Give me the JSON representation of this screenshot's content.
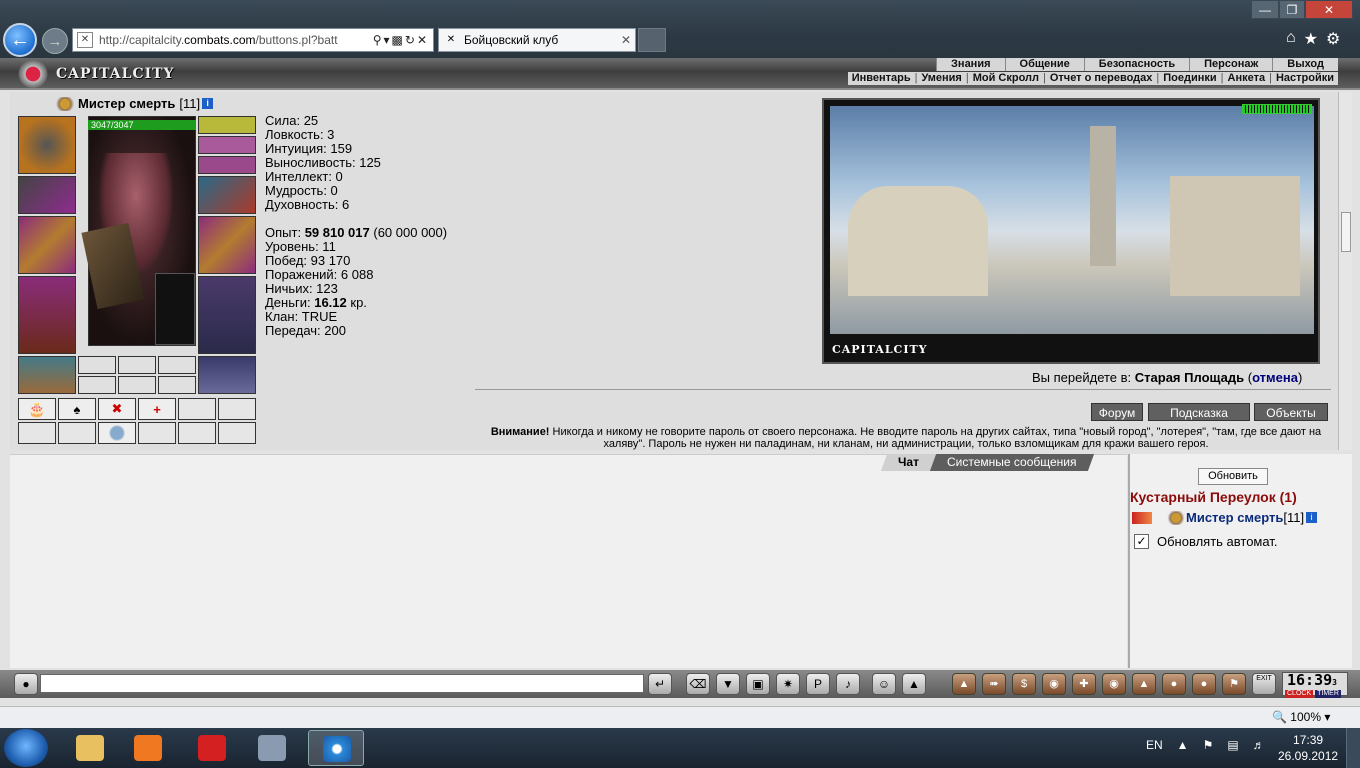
{
  "browser": {
    "url_prefix": "http://capitalcity.",
    "url_domain": "combats.com",
    "url_rest": "/buttons.pl?batt",
    "tab_title": "Бойцовский клуб",
    "zoom": "100%"
  },
  "site": {
    "logo_text": "CAPITALCITY",
    "top_menu": [
      "Знания",
      "Общение",
      "Безопасность",
      "Персонаж",
      "Выход"
    ],
    "sub_menu": [
      "Инвентарь",
      "Умения",
      "Мой Скролл",
      "Отчет о переводах",
      "Поединки",
      "Анкета",
      "Настройки"
    ]
  },
  "character": {
    "name": "Мистер смерть",
    "level": "[11]",
    "hp": "3047/3047"
  },
  "stats": {
    "strength": "Сила: 25",
    "agility": "Ловкость: 3",
    "intuition": "Интуиция: 159",
    "endurance": "Выносливость: 125",
    "intellect": "Интеллект: 0",
    "wisdom": "Мудрость: 0",
    "spirit": "Духовность: 6",
    "exp_label": "Опыт: ",
    "exp_value": "59 810 017",
    "exp_next": " (60 000 000)",
    "level": "Уровень: 11",
    "wins": "Побед: 93 170",
    "losses": "Поражений: 6 088",
    "draws": "Ничьих: 123",
    "money_label": "Деньги: ",
    "money_value": "16.12",
    "money_unit": " кр.",
    "clan": "Клан: TRUE",
    "transfers": "Передач: 200"
  },
  "location": {
    "label": "CAPITALCITY",
    "goto_prefix": "Вы перейдете в: ",
    "goto_place": "Старая Площадь",
    "cancel": "отмена"
  },
  "buttons": {
    "forum": "Форум",
    "hint": "Подсказка",
    "objects": "Объекты"
  },
  "warning": {
    "title": "Внимание!",
    "text": " Никогда и никому не говорите пароль от своего персонажа. Не вводите пароль на других сайтах, типа \"новый город\", \"лотерея\", \"там, где все дают на халяву\". Пароль не нужен ни паладинам, ни кланам, ни администрации, только взломщикам для кражи вашего героя."
  },
  "chat": {
    "tab_chat": "Чат",
    "tab_system": "Системные сообщения"
  },
  "room": {
    "refresh": "Обновить",
    "title": "Кустарный Переулок (1)",
    "user_name": "Мистер смерть",
    "user_level": "[11]",
    "auto_refresh": "Обновлять автомат."
  },
  "clock": {
    "time": "16:39",
    "seconds": "3",
    "label_clock": "CLOCK",
    "label_timer": "TIMER",
    "exit": "EXIT"
  },
  "taskbar": {
    "lang": "EN",
    "time": "17:39",
    "date": "26.09.2012"
  }
}
